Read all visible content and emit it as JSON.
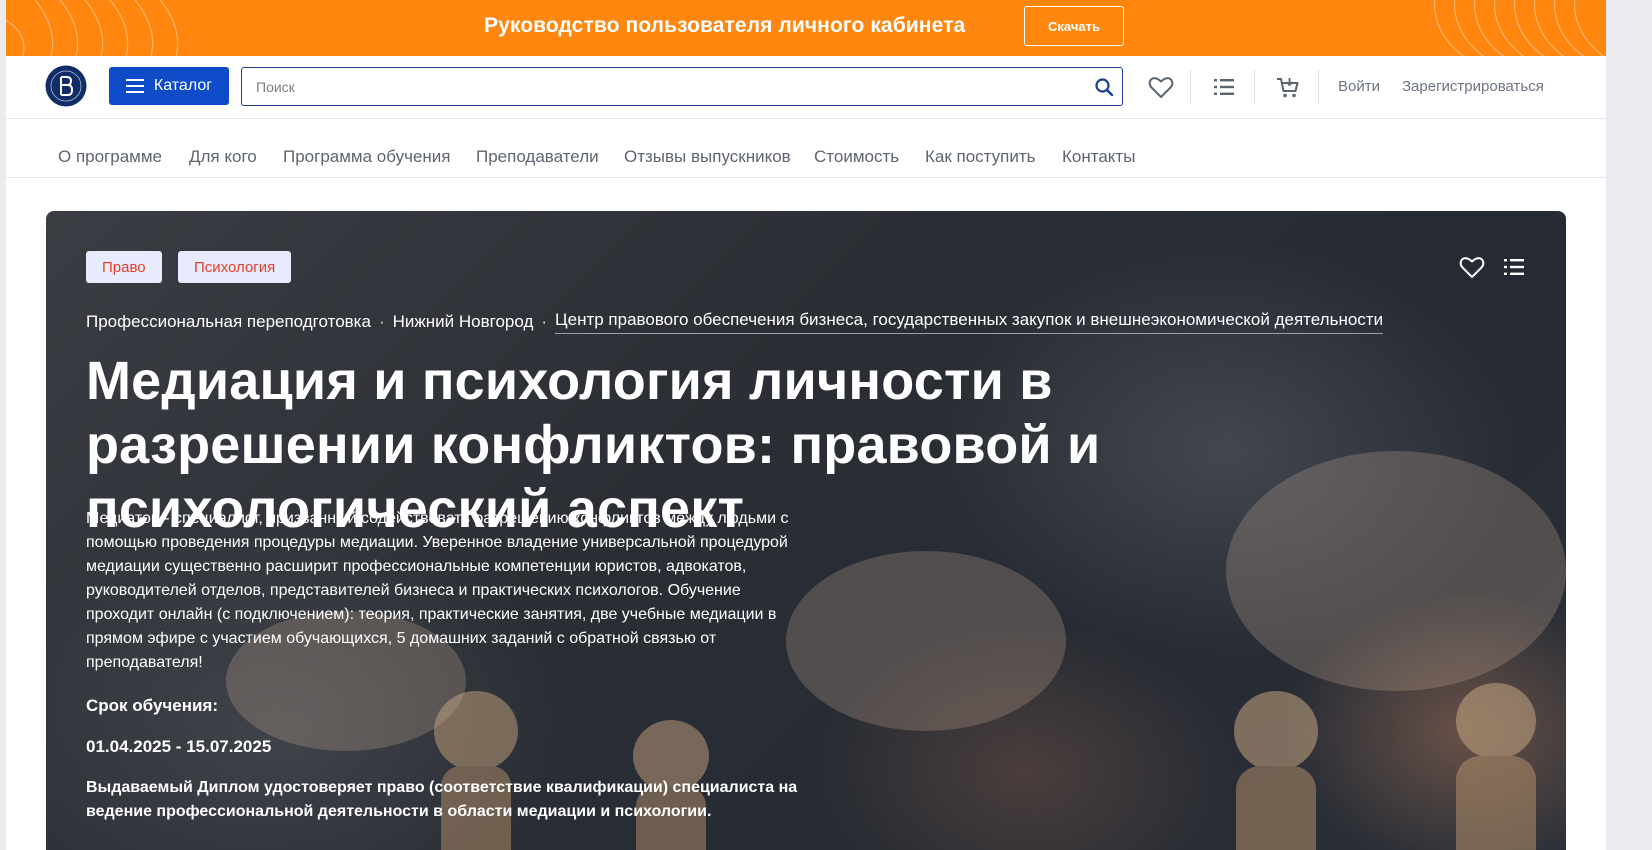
{
  "banner": {
    "title": "Руководство пользователя личного кабинета",
    "button": "Скачать",
    "color": "#ff8710"
  },
  "header": {
    "catalog": "Каталог",
    "search_placeholder": "Поиск",
    "login": "Войти",
    "register": "Зарегистрироваться",
    "icons": [
      "hse-logo-icon",
      "menu-icon",
      "search-icon",
      "heart-icon",
      "list-icon",
      "cart-icon"
    ],
    "accent": "#0d4bc8"
  },
  "subnav": {
    "items": [
      "О программе",
      "Для кого",
      "Программа обучения",
      "Преподаватели",
      "Отзывы выпускников",
      "Стоимость",
      "Как поступить",
      "Контакты"
    ]
  },
  "hero": {
    "tags": [
      "Право",
      "Психология"
    ],
    "breadcrumbs": {
      "type": "Профессиональная переподготовка",
      "city": "Нижний Новгород",
      "center": "Центр правового обеспечения бизнеса, государственных закупок и внешнеэкономической деятельности",
      "separator": "·"
    },
    "title": "Медиация и психология личности в разрешении конфликтов: правовой и психологический аспект",
    "description": "Медиатор - специалист, призванный содействовать разрешению конфликтов между людьми с помощью проведения процедуры медиации. Уверенное владение универсальной процедурой медиации существенно расширит профессиональные компетенции юристов, адвокатов, руководителей отделов, представителей бизнеса и практических психологов. Обучение проходит онлайн (с подключением): теория, практические занятия, две учебные медиации в прямом эфире с участием обучающихся, 5 домашних заданий с обратной связью от преподавателя!",
    "duration_label": "Срок обучения:",
    "dates": "01.04.2025 - 15.07.2025",
    "diploma": "Выдаваемый Диплом  удостоверяет право (соответствие квалификации) специалиста на ведение профессиональной деятельности в области медиации и психологии.",
    "tag_text_color": "#e2402f"
  }
}
